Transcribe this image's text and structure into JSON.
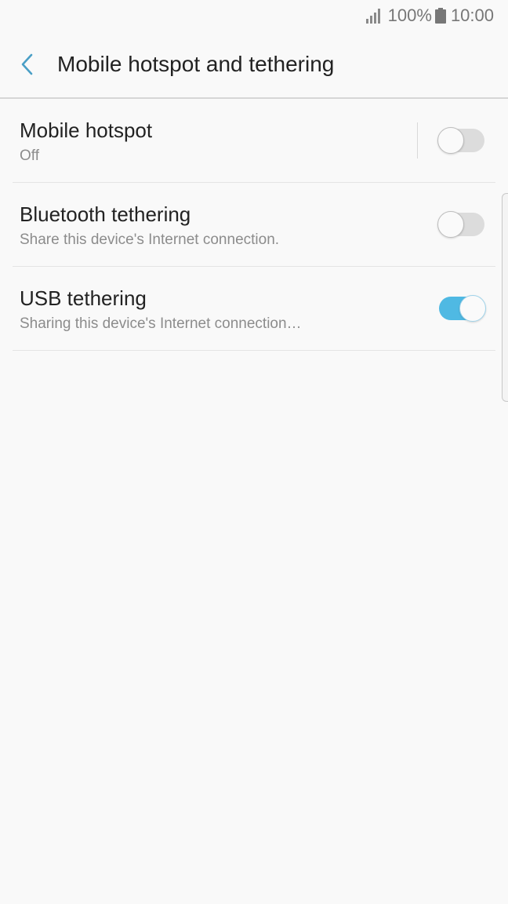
{
  "status_bar": {
    "battery_percent": "100%",
    "time": "10:00",
    "icons": [
      "signal-icon",
      "battery-icon"
    ]
  },
  "header": {
    "title": "Mobile hotspot and tethering",
    "back_icon": "chevron-left-icon"
  },
  "items": [
    {
      "title": "Mobile hotspot",
      "subtitle": "Off",
      "toggle_on": false
    },
    {
      "title": "Bluetooth tethering",
      "subtitle": "Share this device's Internet connection.",
      "toggle_on": false
    },
    {
      "title": "USB tethering",
      "subtitle": "Sharing this device's Internet connection…",
      "toggle_on": true
    }
  ],
  "colors": {
    "accent": "#4fb9e3",
    "back_arrow": "#4a9fc6",
    "background": "#f9f9f9"
  }
}
